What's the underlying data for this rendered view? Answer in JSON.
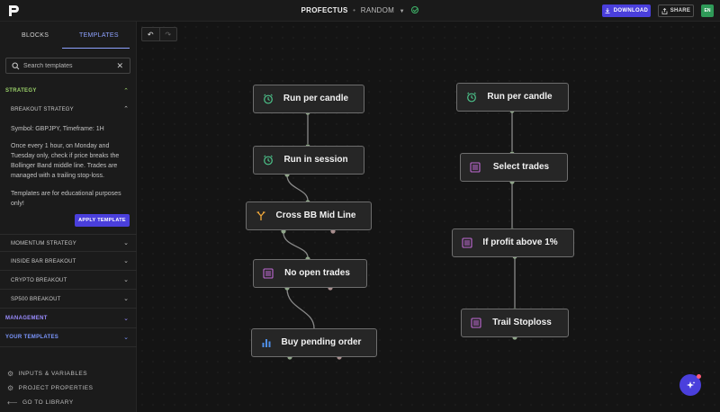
{
  "header": {
    "project_name": "PROFECTUS",
    "separator": "•",
    "mode": "RANDOM",
    "download_label": "DOWNLOAD",
    "share_label": "SHARE",
    "avatar_initials": "EN"
  },
  "sidebar": {
    "tabs": [
      "BLOCKS",
      "TEMPLATES"
    ],
    "active_tab": "TEMPLATES",
    "search_placeholder": "Search templates",
    "strategy_label": "STRATEGY",
    "breakout": {
      "label": "BREAKOUT STRATEGY",
      "symbol_line": "Symbol: GBPJPY, Timeframe: 1H",
      "description": "Once every 1 hour, on Monday and Tuesday only, check if price breaks the Bollinger Band middle line. Trades are managed with a trailing stop-loss.",
      "disclaimer": "Templates are for educational purposes only!",
      "apply_label": "APPLY TEMPLATE"
    },
    "items": [
      "MOMENTUM STRATEGY",
      "INSIDE BAR BREAKOUT",
      "CRYPTO BREAKOUT",
      "SP500 BREAKOUT"
    ],
    "management_label": "MANAGEMENT",
    "your_templates_label": "YOUR TEMPLATES",
    "bottom": [
      "INPUTS & VARIABLES",
      "PROJECT PROPERTIES",
      "GO TO LIBRARY"
    ]
  },
  "canvas": {
    "left_flow": [
      {
        "label": "Run per candle",
        "icon": "clock-icon"
      },
      {
        "label": "Run in session",
        "icon": "clock-icon"
      },
      {
        "label": "Cross BB Mid Line",
        "icon": "branch-icon"
      },
      {
        "label": "No open trades",
        "icon": "list-icon"
      },
      {
        "label": "Buy pending order",
        "icon": "bar-chart-icon"
      }
    ],
    "right_flow": [
      {
        "label": "Run per candle",
        "icon": "clock-icon"
      },
      {
        "label": "Select trades",
        "icon": "list-icon"
      },
      {
        "label": "If profit above 1%",
        "icon": "list-icon"
      },
      {
        "label": "Trail Stoploss",
        "icon": "list-icon"
      }
    ]
  },
  "colors": {
    "accent": "#4a3fdc",
    "clock": "#4cc38a",
    "list": "#c069d4",
    "branch": "#f2a93b",
    "chart": "#4f8fe8",
    "port_green": "#8fb08a",
    "port_red": "#b08a8a"
  }
}
